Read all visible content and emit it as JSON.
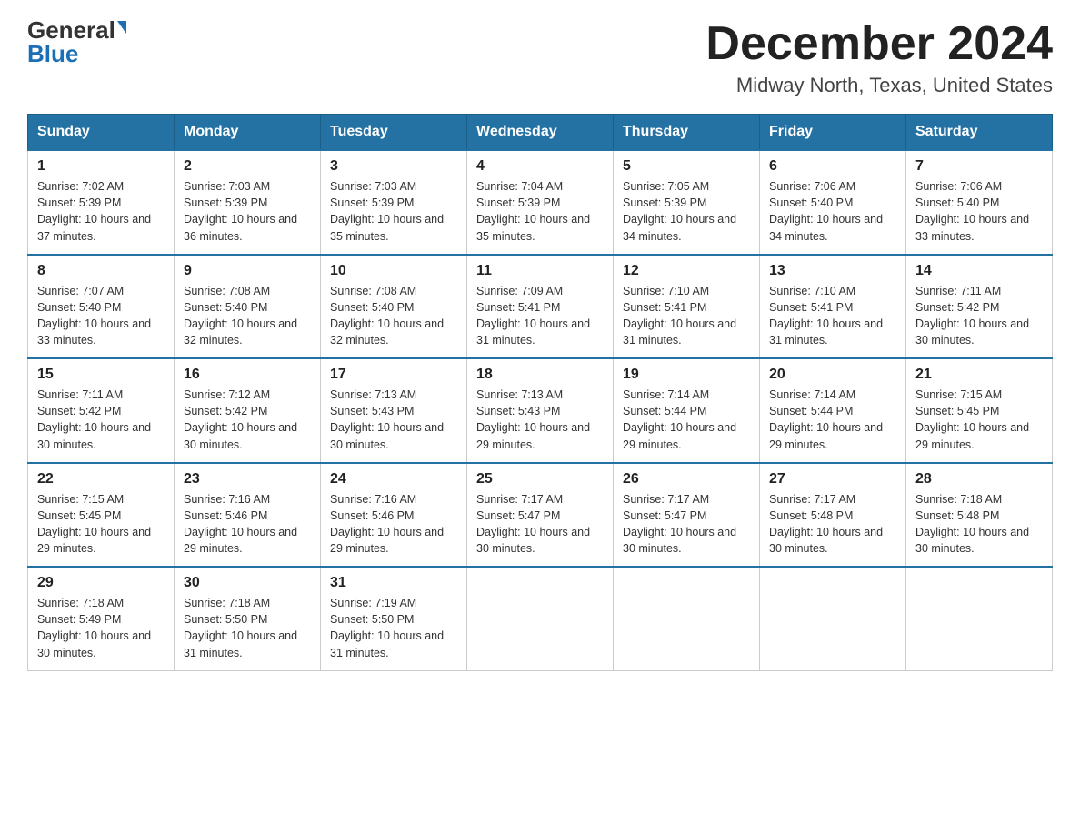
{
  "logo": {
    "general": "General",
    "blue": "Blue"
  },
  "title": "December 2024",
  "subtitle": "Midway North, Texas, United States",
  "headers": [
    "Sunday",
    "Monday",
    "Tuesday",
    "Wednesday",
    "Thursday",
    "Friday",
    "Saturday"
  ],
  "weeks": [
    [
      {
        "day": "1",
        "sunrise": "7:02 AM",
        "sunset": "5:39 PM",
        "daylight": "10 hours and 37 minutes."
      },
      {
        "day": "2",
        "sunrise": "7:03 AM",
        "sunset": "5:39 PM",
        "daylight": "10 hours and 36 minutes."
      },
      {
        "day": "3",
        "sunrise": "7:03 AM",
        "sunset": "5:39 PM",
        "daylight": "10 hours and 35 minutes."
      },
      {
        "day": "4",
        "sunrise": "7:04 AM",
        "sunset": "5:39 PM",
        "daylight": "10 hours and 35 minutes."
      },
      {
        "day": "5",
        "sunrise": "7:05 AM",
        "sunset": "5:39 PM",
        "daylight": "10 hours and 34 minutes."
      },
      {
        "day": "6",
        "sunrise": "7:06 AM",
        "sunset": "5:40 PM",
        "daylight": "10 hours and 34 minutes."
      },
      {
        "day": "7",
        "sunrise": "7:06 AM",
        "sunset": "5:40 PM",
        "daylight": "10 hours and 33 minutes."
      }
    ],
    [
      {
        "day": "8",
        "sunrise": "7:07 AM",
        "sunset": "5:40 PM",
        "daylight": "10 hours and 33 minutes."
      },
      {
        "day": "9",
        "sunrise": "7:08 AM",
        "sunset": "5:40 PM",
        "daylight": "10 hours and 32 minutes."
      },
      {
        "day": "10",
        "sunrise": "7:08 AM",
        "sunset": "5:40 PM",
        "daylight": "10 hours and 32 minutes."
      },
      {
        "day": "11",
        "sunrise": "7:09 AM",
        "sunset": "5:41 PM",
        "daylight": "10 hours and 31 minutes."
      },
      {
        "day": "12",
        "sunrise": "7:10 AM",
        "sunset": "5:41 PM",
        "daylight": "10 hours and 31 minutes."
      },
      {
        "day": "13",
        "sunrise": "7:10 AM",
        "sunset": "5:41 PM",
        "daylight": "10 hours and 31 minutes."
      },
      {
        "day": "14",
        "sunrise": "7:11 AM",
        "sunset": "5:42 PM",
        "daylight": "10 hours and 30 minutes."
      }
    ],
    [
      {
        "day": "15",
        "sunrise": "7:11 AM",
        "sunset": "5:42 PM",
        "daylight": "10 hours and 30 minutes."
      },
      {
        "day": "16",
        "sunrise": "7:12 AM",
        "sunset": "5:42 PM",
        "daylight": "10 hours and 30 minutes."
      },
      {
        "day": "17",
        "sunrise": "7:13 AM",
        "sunset": "5:43 PM",
        "daylight": "10 hours and 30 minutes."
      },
      {
        "day": "18",
        "sunrise": "7:13 AM",
        "sunset": "5:43 PM",
        "daylight": "10 hours and 29 minutes."
      },
      {
        "day": "19",
        "sunrise": "7:14 AM",
        "sunset": "5:44 PM",
        "daylight": "10 hours and 29 minutes."
      },
      {
        "day": "20",
        "sunrise": "7:14 AM",
        "sunset": "5:44 PM",
        "daylight": "10 hours and 29 minutes."
      },
      {
        "day": "21",
        "sunrise": "7:15 AM",
        "sunset": "5:45 PM",
        "daylight": "10 hours and 29 minutes."
      }
    ],
    [
      {
        "day": "22",
        "sunrise": "7:15 AM",
        "sunset": "5:45 PM",
        "daylight": "10 hours and 29 minutes."
      },
      {
        "day": "23",
        "sunrise": "7:16 AM",
        "sunset": "5:46 PM",
        "daylight": "10 hours and 29 minutes."
      },
      {
        "day": "24",
        "sunrise": "7:16 AM",
        "sunset": "5:46 PM",
        "daylight": "10 hours and 29 minutes."
      },
      {
        "day": "25",
        "sunrise": "7:17 AM",
        "sunset": "5:47 PM",
        "daylight": "10 hours and 30 minutes."
      },
      {
        "day": "26",
        "sunrise": "7:17 AM",
        "sunset": "5:47 PM",
        "daylight": "10 hours and 30 minutes."
      },
      {
        "day": "27",
        "sunrise": "7:17 AM",
        "sunset": "5:48 PM",
        "daylight": "10 hours and 30 minutes."
      },
      {
        "day": "28",
        "sunrise": "7:18 AM",
        "sunset": "5:48 PM",
        "daylight": "10 hours and 30 minutes."
      }
    ],
    [
      {
        "day": "29",
        "sunrise": "7:18 AM",
        "sunset": "5:49 PM",
        "daylight": "10 hours and 30 minutes."
      },
      {
        "day": "30",
        "sunrise": "7:18 AM",
        "sunset": "5:50 PM",
        "daylight": "10 hours and 31 minutes."
      },
      {
        "day": "31",
        "sunrise": "7:19 AM",
        "sunset": "5:50 PM",
        "daylight": "10 hours and 31 minutes."
      },
      null,
      null,
      null,
      null
    ]
  ]
}
